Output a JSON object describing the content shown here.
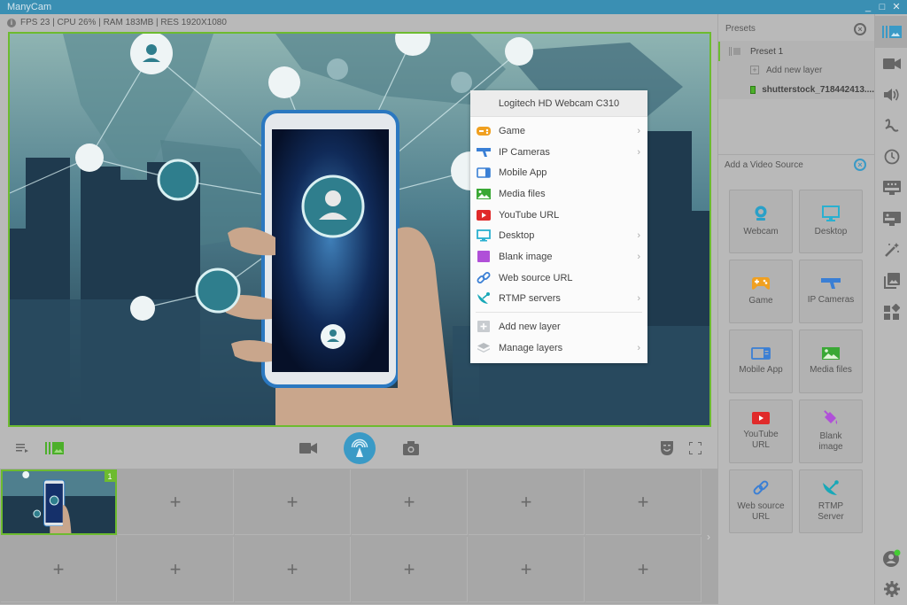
{
  "window": {
    "title": "ManyCam",
    "controls": {
      "minimize": "_",
      "maximize": "□",
      "close": "✕"
    }
  },
  "status": {
    "text": "FPS 23 | CPU 26% | RAM 183MB | RES 1920X1080",
    "info_icon": "i"
  },
  "context_menu": {
    "header": "Logitech HD Webcam C310",
    "items": [
      {
        "label": "Game",
        "icon": "gamepad-icon",
        "color": "#f0a020",
        "submenu": true
      },
      {
        "label": "IP Cameras",
        "icon": "ip-camera-icon",
        "color": "#3a7fd5",
        "submenu": true
      },
      {
        "label": "Mobile App",
        "icon": "mobile-app-icon",
        "color": "#3a7fd5",
        "submenu": false
      },
      {
        "label": "Media files",
        "icon": "image-icon",
        "color": "#3aa835",
        "submenu": false
      },
      {
        "label": "YouTube URL",
        "icon": "youtube-icon",
        "color": "#e02a2a",
        "submenu": false
      },
      {
        "label": "Desktop",
        "icon": "monitor-icon",
        "color": "#2ab0d0",
        "submenu": true
      },
      {
        "label": "Blank image",
        "icon": "blank-image-icon",
        "color": "#b050d8",
        "submenu": true
      },
      {
        "label": "Web source URL",
        "icon": "link-icon",
        "color": "#3a7fd5",
        "submenu": false
      },
      {
        "label": "RTMP servers",
        "icon": "satellite-dish-icon",
        "color": "#18a8b8",
        "submenu": true
      }
    ],
    "footer_items": [
      {
        "label": "Add new layer",
        "icon": "add-layer-icon",
        "submenu": false
      },
      {
        "label": "Manage layers",
        "icon": "layers-icon",
        "submenu": true
      }
    ],
    "chevron": "›"
  },
  "toolbar": {
    "playlist_icon": "playlist-icon",
    "layers_icon": "layers-panel-icon",
    "video_icon": "video-camera-icon",
    "broadcast_icon": "broadcast-icon",
    "snapshot_icon": "camera-icon",
    "effects_icon": "theater-mask-icon",
    "fullscreen_icon": "fullscreen-icon"
  },
  "grid": {
    "active_badge": "1",
    "add_symbol": "+",
    "next": "›"
  },
  "presets": {
    "title": "Presets",
    "close": "×",
    "preset_name": "Preset 1",
    "add_layer": "Add new layer",
    "layer_name": "shutterstock_718442413...."
  },
  "video_source": {
    "title": "Add a Video Source",
    "close": "×",
    "tiles": [
      {
        "label": "Webcam",
        "icon": "webcam-icon",
        "color": "#2aa0c8"
      },
      {
        "label": "Desktop",
        "icon": "monitor-icon",
        "color": "#2ab0d0"
      },
      {
        "label": "Game",
        "icon": "gamepad-icon",
        "color": "#f0a020"
      },
      {
        "label": "IP Cameras",
        "icon": "ip-camera-icon",
        "color": "#3a7fd5"
      },
      {
        "label": "Mobile App",
        "icon": "mobile-app-icon",
        "color": "#3a7fd5"
      },
      {
        "label": "Media files",
        "icon": "image-icon",
        "color": "#3aa835"
      },
      {
        "label": "YouTube URL",
        "icon": "youtube-icon",
        "color": "#e02a2a"
      },
      {
        "label": "Blank image",
        "icon": "paint-bucket-icon",
        "color": "#b050d8"
      },
      {
        "label": "Web source URL",
        "icon": "link-icon",
        "color": "#3a7fd5"
      },
      {
        "label": "RTMP Server",
        "icon": "satellite-dish-icon",
        "color": "#18a8b8"
      }
    ]
  },
  "sidebar_icons": [
    "presets-icon",
    "video-camera-icon",
    "speaker-icon",
    "drawing-icon",
    "clock-icon",
    "lower-thirds-icon",
    "chroma-key-icon",
    "magic-wand-icon",
    "media-gallery-icon",
    "widgets-icon"
  ],
  "sidebar_bottom": [
    "account-icon",
    "settings-icon"
  ],
  "colors": {
    "accent": "#3a9ac6",
    "active_green": "#6dbb2f",
    "titlebar": "#3a8fb3",
    "status_online": "#44cc33"
  }
}
